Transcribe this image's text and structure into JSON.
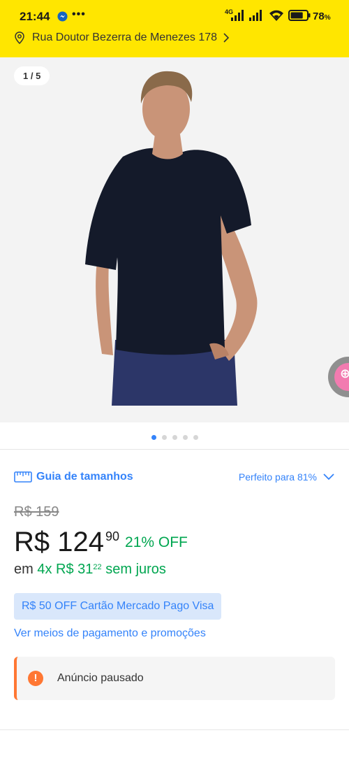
{
  "status_bar": {
    "time": "21:44",
    "network_label": "4G",
    "battery_percent": "78",
    "battery_unit": "%",
    "battery_level": 0.78,
    "icons": [
      "messenger-icon",
      "more-dots-icon",
      "signal-icon",
      "wifi-icon",
      "battery-icon"
    ]
  },
  "address": {
    "text": "Rua Doutor Bezerra de Menezes 178"
  },
  "gallery": {
    "counter": "1 / 5",
    "total_images": 5,
    "active_index": 0
  },
  "size": {
    "guide_label": "Guia de tamanhos",
    "fit_label": "Perfeito para 81%"
  },
  "price": {
    "original": "R$ 159",
    "current_main": "R$ 124",
    "current_cents": "90",
    "discount": "21% OFF",
    "installment_prefix": "em",
    "installment_count": "4x R$ 31",
    "installment_cents": "22",
    "installment_suffix": "sem juros"
  },
  "promo": {
    "label": "R$ 50 OFF Cartão Mercado Pago Visa"
  },
  "payment_link": "Ver meios de pagamento e promoções",
  "alert": {
    "text": "Anúncio pausado"
  },
  "colors": {
    "header_yellow": "#ffe600",
    "link_blue": "#3483fa",
    "discount_green": "#00a650",
    "warning_orange": "#ff7733"
  }
}
